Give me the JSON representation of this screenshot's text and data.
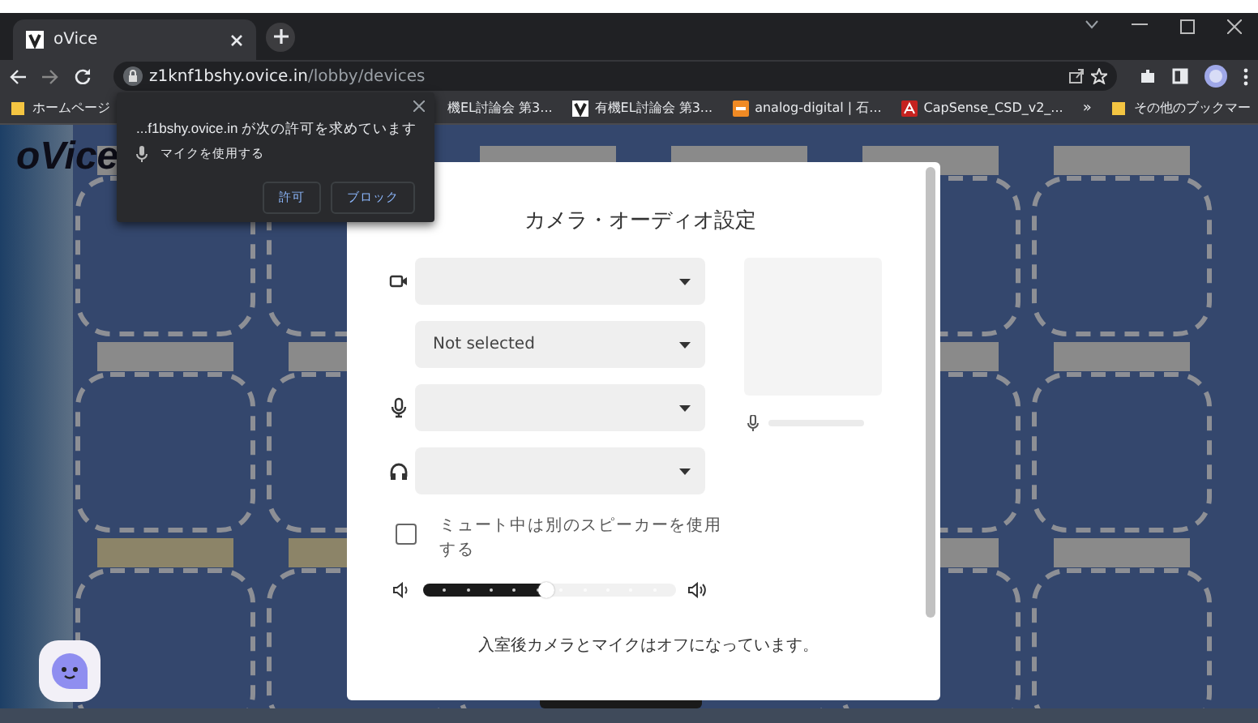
{
  "browser": {
    "tabs": [
      {
        "title": "oVice",
        "selected": true
      }
    ],
    "address": {
      "host": "z1knf1bshy.ovice.in",
      "path": "/lobby/devices"
    },
    "bookmarks": [
      {
        "label": "ホームページ",
        "kind": "folder"
      },
      {
        "label": "機EL討論会 第3...",
        "kind": "plain"
      },
      {
        "label": "有機EL討論会 第3...",
        "kind": "site"
      },
      {
        "label": "analog-digital | 石...",
        "kind": "orange"
      },
      {
        "label": "CapSense_CSD_v2_...",
        "kind": "pdf"
      }
    ],
    "more": "»",
    "other_bookmarks": "その他のブックマー"
  },
  "permission_popup": {
    "title": "...f1bshy.ovice.in が次の許可を求めています",
    "request": "マイクを使用する",
    "buttons": [
      "許可",
      "ブロック"
    ]
  },
  "app": {
    "logo": "oVice",
    "settings": {
      "title": "カメラ・オーディオ設定",
      "selects": [
        {
          "kind": "camera"
        },
        {
          "kind": "none",
          "value": "Not selected"
        },
        {
          "kind": "mic"
        },
        {
          "kind": "headphones"
        }
      ],
      "checkbox": {
        "label": "ミュート中は別のスピーカーを使用する",
        "checked": false
      },
      "volume": {
        "level": 0.49
      },
      "note": "入室後カメラとマイクはオフになっています。"
    }
  }
}
